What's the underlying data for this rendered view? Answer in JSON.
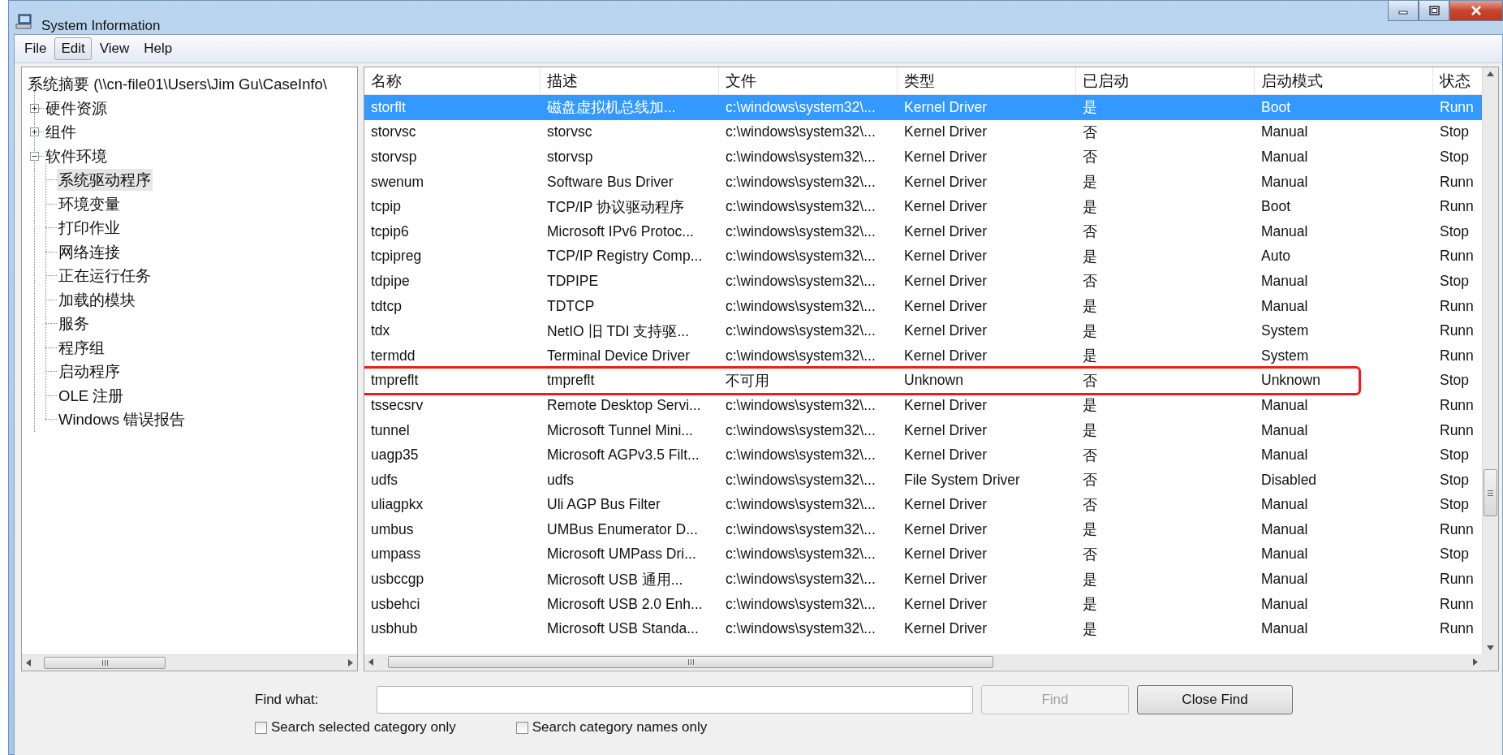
{
  "window": {
    "title": "System Information"
  },
  "menu": [
    {
      "label": "File",
      "selected": false
    },
    {
      "label": "Edit",
      "selected": true
    },
    {
      "label": "View",
      "selected": false
    },
    {
      "label": "Help",
      "selected": false
    }
  ],
  "tree": {
    "label": "系统摘要 (\\\\cn-file01\\Users\\Jim Gu\\CaseInfo\\",
    "selected": false,
    "children": [
      {
        "label": "硬件资源",
        "expanded": false,
        "selected": false
      },
      {
        "label": "组件",
        "expanded": false,
        "selected": false
      },
      {
        "label": "软件环境",
        "expanded": true,
        "selected": false,
        "children": [
          {
            "label": "系统驱动程序",
            "selected": true
          },
          {
            "label": "环境变量",
            "selected": false
          },
          {
            "label": "打印作业",
            "selected": false
          },
          {
            "label": "网络连接",
            "selected": false
          },
          {
            "label": "正在运行任务",
            "selected": false
          },
          {
            "label": "加载的模块",
            "selected": false
          },
          {
            "label": "服务",
            "selected": false
          },
          {
            "label": "程序组",
            "selected": false
          },
          {
            "label": "启动程序",
            "selected": false
          },
          {
            "label": "OLE 注册",
            "selected": false
          },
          {
            "label": "Windows 错误报告",
            "selected": false
          }
        ]
      }
    ]
  },
  "table": {
    "columns": [
      "名称",
      "描述",
      "文件",
      "类型",
      "已启动",
      "启动模式",
      "状态"
    ],
    "rows": [
      {
        "cells": [
          "storflt",
          "磁盘虚拟机总线加...",
          "c:\\windows\\system32\\...",
          "Kernel Driver",
          "是",
          "Boot",
          "Runn"
        ],
        "selected": true,
        "annotated": false
      },
      {
        "cells": [
          "storvsc",
          "storvsc",
          "c:\\windows\\system32\\...",
          "Kernel Driver",
          "否",
          "Manual",
          "Stop"
        ],
        "selected": false,
        "annotated": false
      },
      {
        "cells": [
          "storvsp",
          "storvsp",
          "c:\\windows\\system32\\...",
          "Kernel Driver",
          "否",
          "Manual",
          "Stop"
        ],
        "selected": false,
        "annotated": false
      },
      {
        "cells": [
          "swenum",
          "Software Bus Driver",
          "c:\\windows\\system32\\...",
          "Kernel Driver",
          "是",
          "Manual",
          "Runn"
        ],
        "selected": false,
        "annotated": false
      },
      {
        "cells": [
          "tcpip",
          "TCP/IP 协议驱动程序",
          "c:\\windows\\system32\\...",
          "Kernel Driver",
          "是",
          "Boot",
          "Runn"
        ],
        "selected": false,
        "annotated": false
      },
      {
        "cells": [
          "tcpip6",
          "Microsoft IPv6 Protoc...",
          "c:\\windows\\system32\\...",
          "Kernel Driver",
          "否",
          "Manual",
          "Stop"
        ],
        "selected": false,
        "annotated": false
      },
      {
        "cells": [
          "tcpipreg",
          "TCP/IP Registry Comp...",
          "c:\\windows\\system32\\...",
          "Kernel Driver",
          "是",
          "Auto",
          "Runn"
        ],
        "selected": false,
        "annotated": false
      },
      {
        "cells": [
          "tdpipe",
          "TDPIPE",
          "c:\\windows\\system32\\...",
          "Kernel Driver",
          "否",
          "Manual",
          "Stop"
        ],
        "selected": false,
        "annotated": false
      },
      {
        "cells": [
          "tdtcp",
          "TDTCP",
          "c:\\windows\\system32\\...",
          "Kernel Driver",
          "是",
          "Manual",
          "Runn"
        ],
        "selected": false,
        "annotated": false
      },
      {
        "cells": [
          "tdx",
          "NetIO 旧 TDI 支持驱...",
          "c:\\windows\\system32\\...",
          "Kernel Driver",
          "是",
          "System",
          "Runn"
        ],
        "selected": false,
        "annotated": false
      },
      {
        "cells": [
          "termdd",
          "Terminal Device Driver",
          "c:\\windows\\system32\\...",
          "Kernel Driver",
          "是",
          "System",
          "Runn"
        ],
        "selected": false,
        "annotated": false
      },
      {
        "cells": [
          "tmpreflt",
          "tmpreflt",
          "不可用",
          "Unknown",
          "否",
          "Unknown",
          "Stop"
        ],
        "selected": false,
        "annotated": true
      },
      {
        "cells": [
          "tssecsrv",
          "Remote Desktop Servi...",
          "c:\\windows\\system32\\...",
          "Kernel Driver",
          "是",
          "Manual",
          "Runn"
        ],
        "selected": false,
        "annotated": false
      },
      {
        "cells": [
          "tunnel",
          "Microsoft Tunnel Mini...",
          "c:\\windows\\system32\\...",
          "Kernel Driver",
          "是",
          "Manual",
          "Runn"
        ],
        "selected": false,
        "annotated": false
      },
      {
        "cells": [
          "uagp35",
          "Microsoft AGPv3.5 Filt...",
          "c:\\windows\\system32\\...",
          "Kernel Driver",
          "否",
          "Manual",
          "Stop"
        ],
        "selected": false,
        "annotated": false
      },
      {
        "cells": [
          "udfs",
          "udfs",
          "c:\\windows\\system32\\...",
          "File System Driver",
          "否",
          "Disabled",
          "Stop"
        ],
        "selected": false,
        "annotated": false
      },
      {
        "cells": [
          "uliagpkx",
          "Uli AGP Bus Filter",
          "c:\\windows\\system32\\...",
          "Kernel Driver",
          "否",
          "Manual",
          "Stop"
        ],
        "selected": false,
        "annotated": false
      },
      {
        "cells": [
          "umbus",
          "UMBus Enumerator D...",
          "c:\\windows\\system32\\...",
          "Kernel Driver",
          "是",
          "Manual",
          "Runn"
        ],
        "selected": false,
        "annotated": false
      },
      {
        "cells": [
          "umpass",
          "Microsoft UMPass Dri...",
          "c:\\windows\\system32\\...",
          "Kernel Driver",
          "否",
          "Manual",
          "Stop"
        ],
        "selected": false,
        "annotated": false
      },
      {
        "cells": [
          "usbccgp",
          "Microsoft USB 通用...",
          "c:\\windows\\system32\\...",
          "Kernel Driver",
          "是",
          "Manual",
          "Runn"
        ],
        "selected": false,
        "annotated": false
      },
      {
        "cells": [
          "usbehci",
          "Microsoft USB 2.0 Enh...",
          "c:\\windows\\system32\\...",
          "Kernel Driver",
          "是",
          "Manual",
          "Runn"
        ],
        "selected": false,
        "annotated": false
      },
      {
        "cells": [
          "usbhub",
          "Microsoft USB Standa...",
          "c:\\windows\\system32\\...",
          "Kernel Driver",
          "是",
          "Manual",
          "Runn"
        ],
        "selected": false,
        "annotated": false
      }
    ]
  },
  "find": {
    "label": "Find what:",
    "buttons": [
      {
        "label": "Find",
        "disabled": true
      },
      {
        "label": "Close Find",
        "disabled": false
      }
    ],
    "options": [
      {
        "label": "Search selected category only",
        "checked": false
      },
      {
        "label": "Search category names only",
        "checked": false
      }
    ]
  }
}
